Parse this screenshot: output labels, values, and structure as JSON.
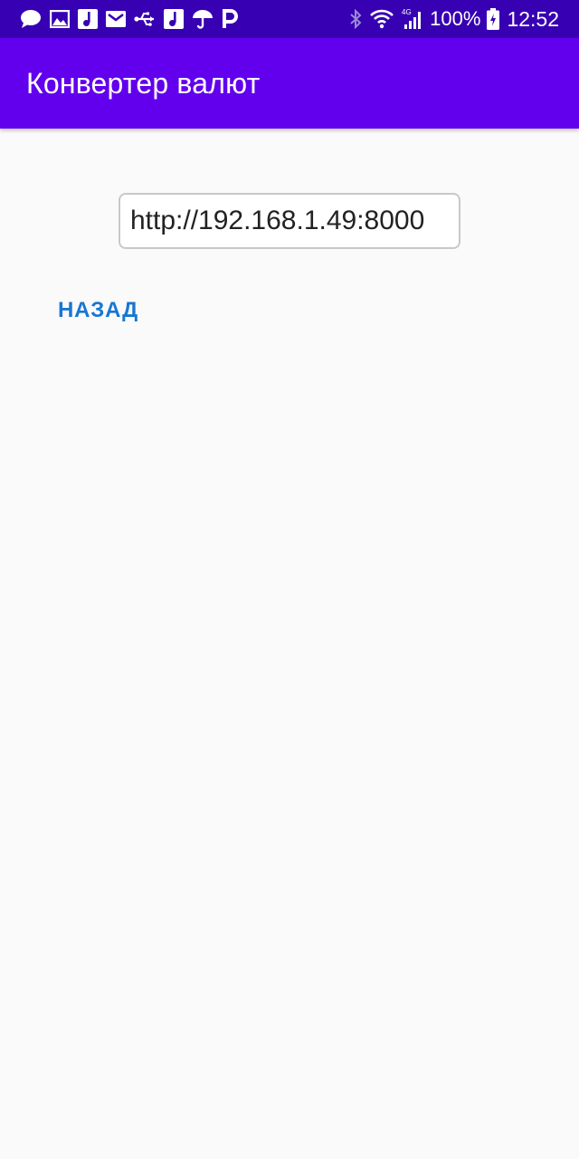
{
  "status_bar": {
    "left_icons": [
      "message-icon",
      "image-icon",
      "music-note-icon",
      "mail-icon",
      "usb-icon",
      "music-note-icon",
      "umbrella-icon",
      "parking-icon"
    ],
    "right_icons": [
      "bluetooth-icon",
      "wifi-icon",
      "signal-4g-icon",
      "battery-charging-icon"
    ],
    "network_label": "4G",
    "battery": "100%",
    "time": "12:52",
    "background_color": "#3700b3"
  },
  "app_bar": {
    "title": "Конвертер валют",
    "background_color": "#6200ee"
  },
  "main": {
    "url_input": {
      "value": "http://192.168.1.49:8000"
    },
    "back_button": {
      "label": "НАЗАД",
      "color": "#1976d2"
    }
  }
}
